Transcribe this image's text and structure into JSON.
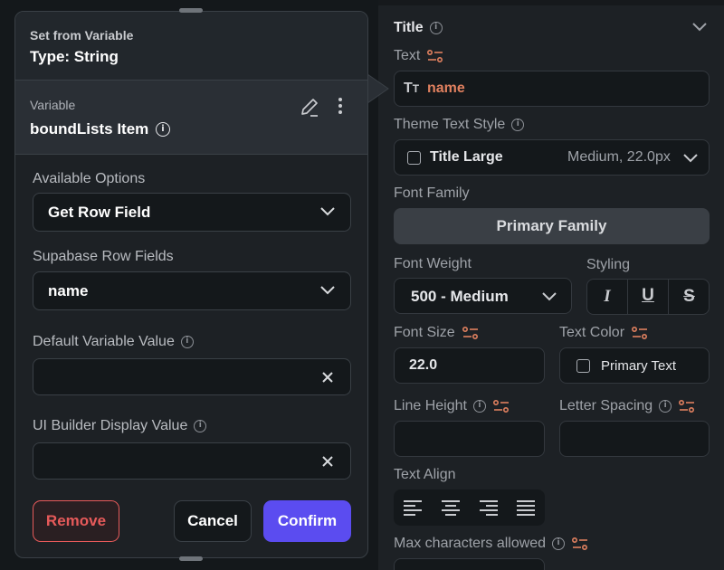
{
  "modal": {
    "header_small": "Set from Variable",
    "header_type": "Type: String",
    "variable_label": "Variable",
    "variable_name": "boundLists Item",
    "available_options_label": "Available Options",
    "available_options_value": "Get Row Field",
    "supabase_fields_label": "Supabase Row Fields",
    "supabase_fields_value": "name",
    "default_value_label": "Default Variable Value",
    "default_value_value": "",
    "ui_builder_label": "UI Builder Display Value",
    "ui_builder_value": "",
    "remove_label": "Remove",
    "cancel_label": "Cancel",
    "confirm_label": "Confirm"
  },
  "props": {
    "title_section": "Title",
    "text_label": "Text",
    "text_value": "name",
    "theme_text_style_label": "Theme Text Style",
    "theme_style_name": "Title Large",
    "theme_style_meta": "Medium, 22.0px",
    "font_family_label": "Font Family",
    "font_family_value": "Primary Family",
    "font_weight_label": "Font Weight",
    "font_weight_value": "500 - Medium",
    "styling_label": "Styling",
    "font_size_label": "Font Size",
    "font_size_value": "22.0",
    "text_color_label": "Text Color",
    "text_color_value": "Primary Text",
    "line_height_label": "Line Height",
    "line_height_value": "",
    "letter_spacing_label": "Letter Spacing",
    "letter_spacing_value": "",
    "text_align_label": "Text Align",
    "max_chars_label": "Max characters allowed"
  },
  "colors": {
    "accent_orange": "#e0805f",
    "confirm_purple": "#5b4cf0",
    "remove_red": "#e65a5a"
  }
}
